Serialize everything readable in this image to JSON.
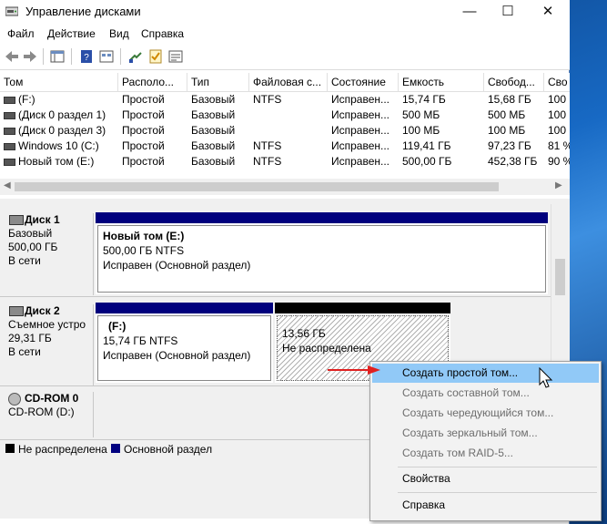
{
  "window": {
    "title": "Управление дисками",
    "minimize": "—",
    "maximize": "☐",
    "close": "✕"
  },
  "menu": [
    "Файл",
    "Действие",
    "Вид",
    "Справка"
  ],
  "table": {
    "columns": [
      "Том",
      "Располо...",
      "Тип",
      "Файловая с...",
      "Состояние",
      "Емкость",
      "Свобод...",
      "Сво"
    ],
    "rows": [
      [
        "(F:)",
        "Простой",
        "Базовый",
        "NTFS",
        "Исправен...",
        "15,74 ГБ",
        "15,68 ГБ",
        "100"
      ],
      [
        "(Диск 0 раздел 1)",
        "Простой",
        "Базовый",
        "",
        "Исправен...",
        "500 МБ",
        "500 МБ",
        "100"
      ],
      [
        "(Диск 0 раздел 3)",
        "Простой",
        "Базовый",
        "",
        "Исправен...",
        "100 МБ",
        "100 МБ",
        "100"
      ],
      [
        "Windows 10 (C:)",
        "Простой",
        "Базовый",
        "NTFS",
        "Исправен...",
        "119,41 ГБ",
        "97,23 ГБ",
        "81 %"
      ],
      [
        "Новый том (E:)",
        "Простой",
        "Базовый",
        "NTFS",
        "Исправен...",
        "500,00 ГБ",
        "452,38 ГБ",
        "90 %"
      ]
    ]
  },
  "disks": {
    "disk1": {
      "name": "Диск 1",
      "type": "Базовый",
      "size": "500,00 ГБ",
      "status": "В сети",
      "partition": {
        "title": "Новый том  (E:)",
        "size": "500,00 ГБ NTFS",
        "status": "Исправен (Основной раздел)"
      }
    },
    "disk2": {
      "name": "Диск 2",
      "type": "Съемное устро",
      "size": "29,31 ГБ",
      "status": "В сети",
      "partition": {
        "title": "(F:)",
        "size": "15,74 ГБ NTFS",
        "status": "Исправен (Основной раздел)"
      },
      "unallocated": {
        "size": "13,56 ГБ",
        "status": "Не распределена"
      }
    },
    "cdrom": {
      "name": "CD-ROM 0",
      "sub": "CD-ROM (D:)"
    }
  },
  "legend": {
    "unallocated": "Не распределена",
    "primary": "Основной раздел",
    "unallocated_color": "#000000",
    "primary_color": "#000080"
  },
  "context_menu": {
    "items": [
      {
        "label": "Создать простой том...",
        "enabled": true,
        "highlighted": true
      },
      {
        "label": "Создать составной том...",
        "enabled": false
      },
      {
        "label": "Создать чередующийся том...",
        "enabled": false
      },
      {
        "label": "Создать зеркальный том...",
        "enabled": false
      },
      {
        "label": "Создать том RAID-5...",
        "enabled": false
      },
      {
        "label": "Свойства",
        "enabled": true
      },
      {
        "label": "Справка",
        "enabled": true
      }
    ]
  },
  "colors": {
    "primary_bar": "#00007d",
    "unallocated_bar": "#000000",
    "highlight": "#91c9f7",
    "arrow": "#e02020"
  }
}
